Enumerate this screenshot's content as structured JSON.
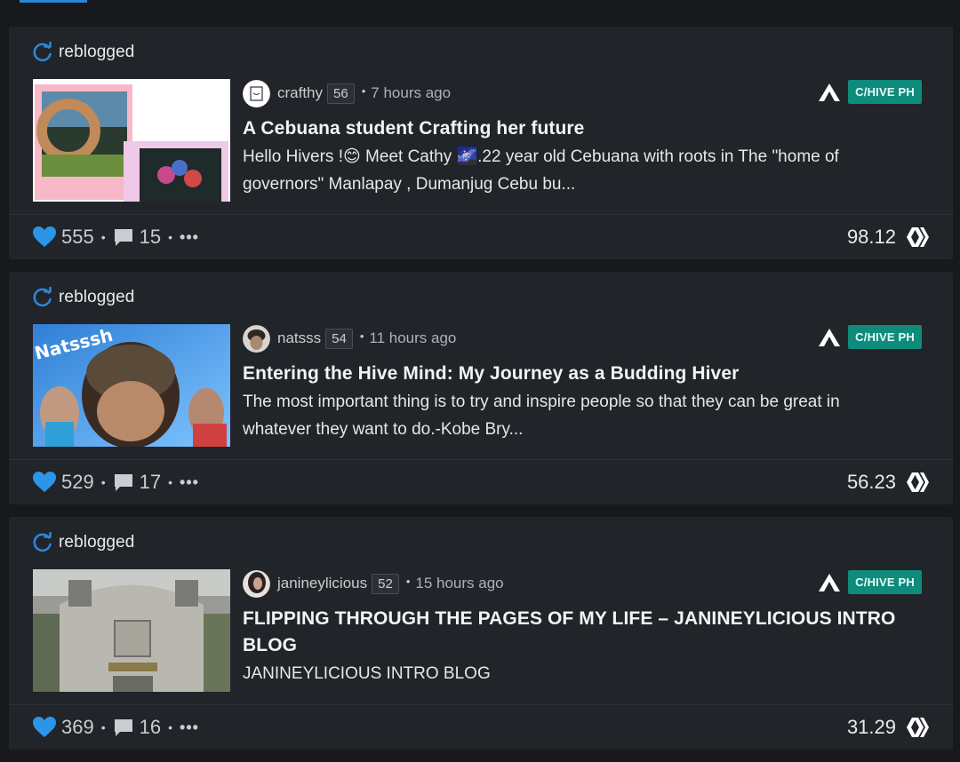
{
  "posts": [
    {
      "reblog_label": "reblogged",
      "author": "crafthy",
      "reputation": "56",
      "time": "7 hours ago",
      "community": "C/HIVE PH",
      "title": "A Cebuana student Crafting her future",
      "summary_line1": "Hello Hivers !😊 Meet Cathy 🌌.22 year old Cebuana with roots in The \"home of",
      "summary_line2": "governors\" Manlapay , Dumanjug Cebu bu...",
      "votes": "555",
      "comments": "15",
      "payout": "98.12"
    },
    {
      "reblog_label": "reblogged",
      "author": "natsss",
      "reputation": "54",
      "time": "11 hours ago",
      "community": "C/HIVE PH",
      "title": "Entering the Hive Mind: My Journey as a Budding Hiver",
      "summary_line1": "The most important thing is to try and inspire people so that they can be great in",
      "summary_line2": "whatever they want to do.-Kobe Bry...",
      "thumb_text": "Natsssh",
      "votes": "529",
      "comments": "17",
      "payout": "56.23"
    },
    {
      "reblog_label": "reblogged",
      "author": "janineylicious",
      "reputation": "52",
      "time": "15 hours ago",
      "community": "C/HIVE PH",
      "title_line1": "FLIPPING THROUGH THE PAGES OF MY LIFE – JANINEYLICIOUS INTRO",
      "title_line2": "BLOG",
      "summary_line1": "JANINEYLICIOUS INTRO BLOG",
      "votes": "369",
      "comments": "16",
      "payout": "31.29"
    }
  ],
  "colors": {
    "accent_blue": "#2b86d8",
    "community_badge": "#0f8b7c",
    "card_bg": "#212429"
  }
}
